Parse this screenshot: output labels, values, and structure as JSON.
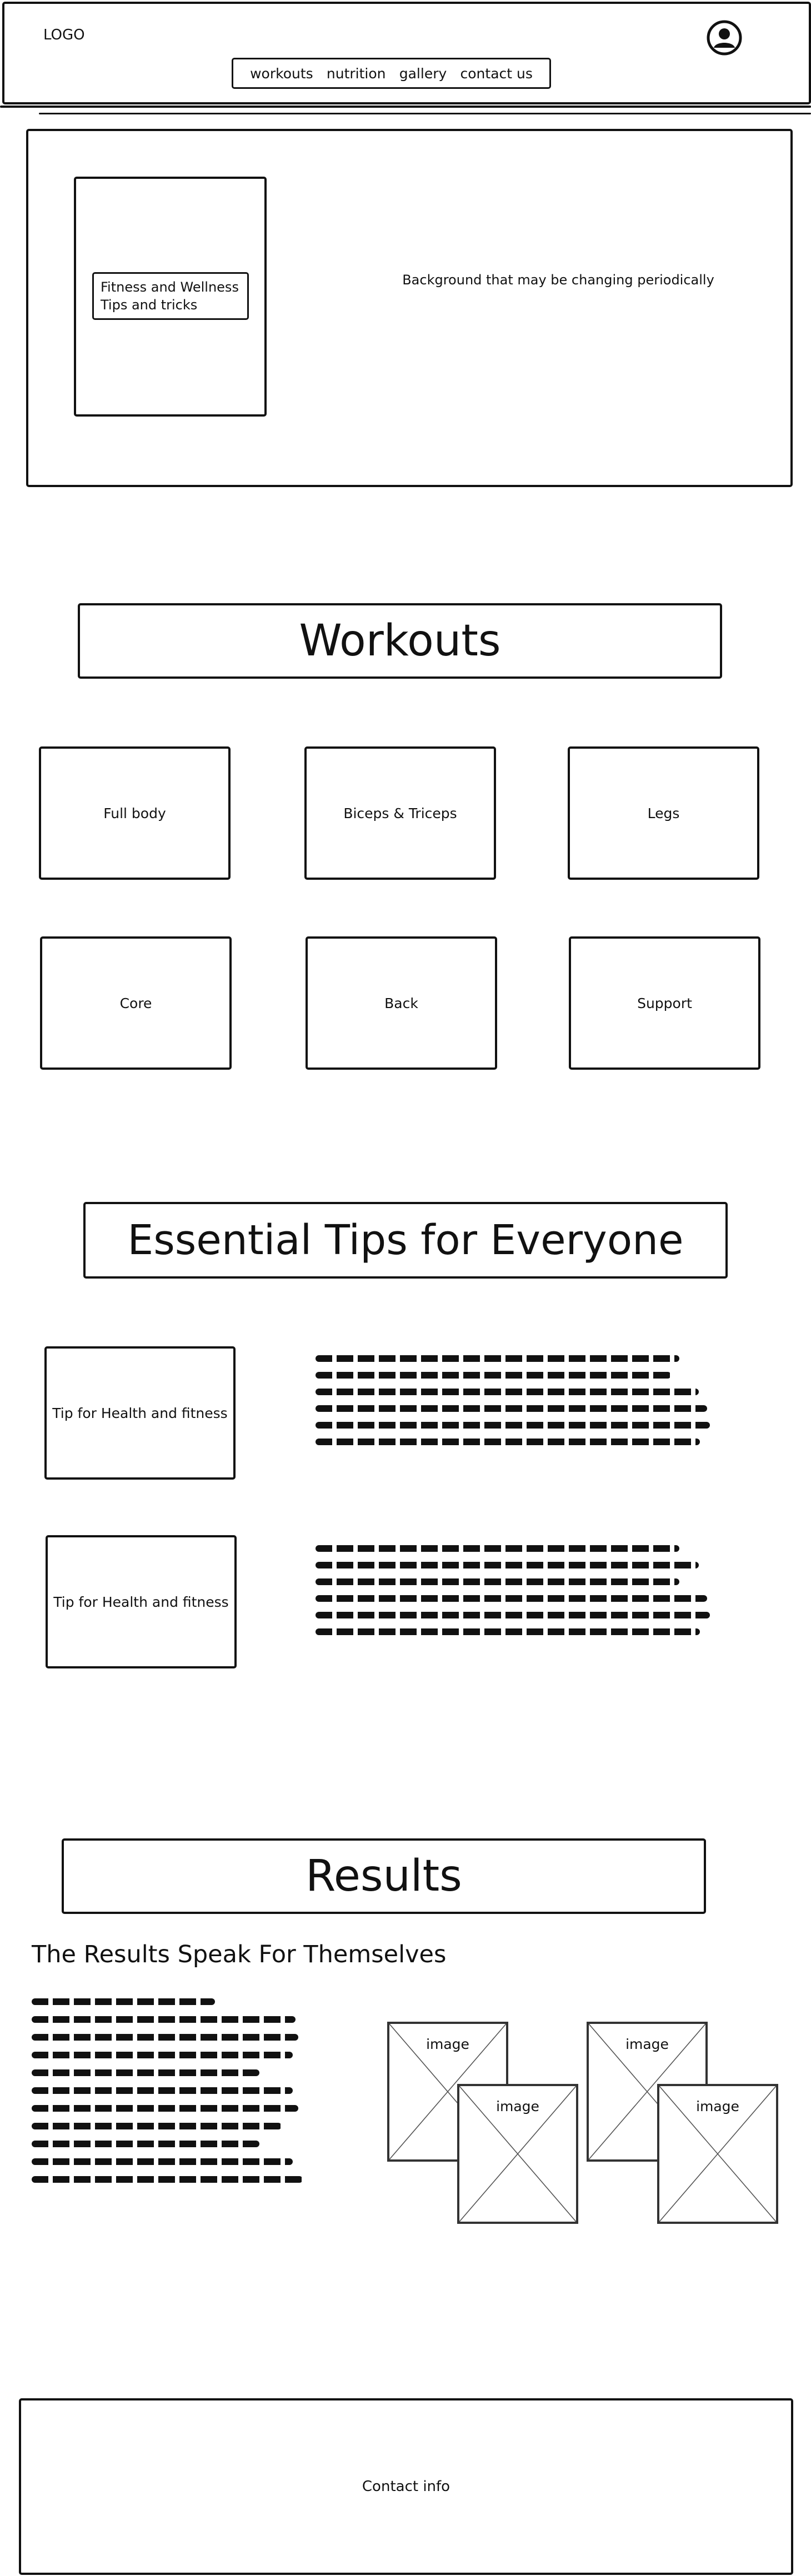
{
  "header": {
    "logo": "LOGO",
    "nav": [
      "workouts",
      "nutrition",
      "gallery",
      "contact us"
    ],
    "profile_icon": "user-circle-icon"
  },
  "hero": {
    "title": "Fitness and Wellness Tips and tricks",
    "background_note": "Background that may be changing periodically"
  },
  "workouts": {
    "title": "Workouts",
    "cards": [
      "Full body",
      "Biceps & Triceps",
      "Legs",
      "Core",
      "Back",
      "Support"
    ]
  },
  "tips": {
    "title": "Essential Tips for Everyone",
    "items": [
      "Tip for Health and fitness",
      "Tip for Health and fitness"
    ]
  },
  "results": {
    "title": "Results",
    "subtitle": "The Results Speak For Themselves",
    "image_label": "image"
  },
  "footer": {
    "contact": "Contact info"
  }
}
